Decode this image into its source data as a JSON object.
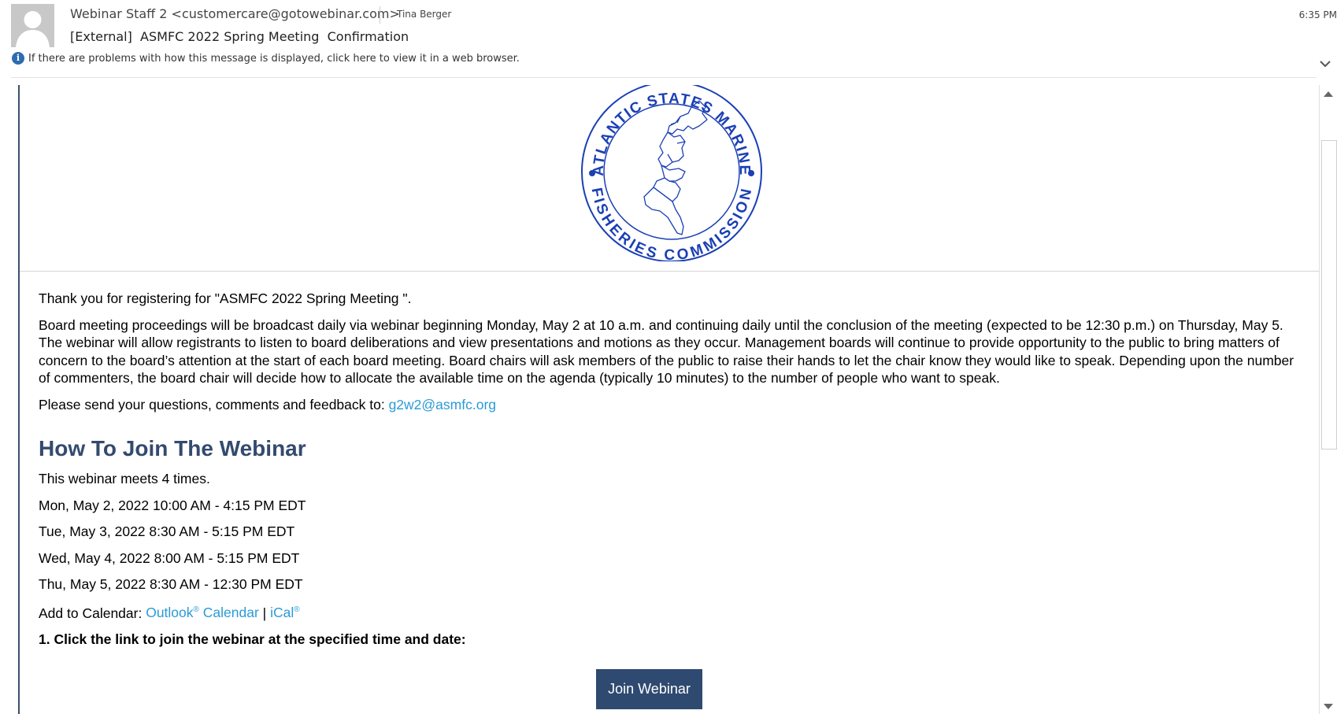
{
  "header": {
    "from": "Webinar Staff 2 <customercare@gotowebinar.com>",
    "to": "Tina Berger",
    "time": "6:35 PM",
    "subject": "[External]  ASMFC 2022 Spring Meeting  Confirmation",
    "info_text": "If there are problems with how this message is displayed, click here to view it in a web browser."
  },
  "logo": {
    "top_text": "ATLANTIC STATES MARINE",
    "bottom_text": "FISHERIES COMMISSION",
    "color": "#1a3fb5"
  },
  "email": {
    "thanks": "Thank you for registering for \"ASMFC 2022 Spring Meeting \".",
    "paragraph": "Board meeting proceedings will be broadcast daily via webinar beginning Monday, May 2 at 10 a.m. and continuing daily until the conclusion of the meeting (expected to be 12:30 p.m.) on Thursday, May 5. The webinar will allow registrants to listen to board deliberations and view presentations and motions as they occur. Management boards will continue to provide opportunity to the public to bring matters of concern to the board’s attention at the start of each board meeting. Board chairs will ask members of the public to raise their hands to let the chair know they would like to speak. Depending upon the number of commenters, the board chair will decide how to allocate the available time on the agenda (typically 10 minutes) to the number of people who want to speak.",
    "feedback_text": "Please send your questions, comments and feedback to: ",
    "feedback_email": "g2w2@asmfc.org",
    "heading": "How To Join The Webinar",
    "meets": "This webinar meets 4 times.",
    "sessions": [
      "Mon, May 2, 2022 10:00 AM - 4:15 PM EDT",
      "Tue, May 3, 2022 8:30 AM - 5:15 PM EDT",
      "Wed, May 4, 2022 8:00 AM - 5:15 PM EDT",
      "Thu, May 5, 2022 8:30 AM - 12:30 PM EDT"
    ],
    "calendar_label": "Add to Calendar: ",
    "outlook": "Outlook",
    "outlook_reg": "®",
    "calendar_word": " Calendar",
    "pipe": " | ",
    "ical": "iCal",
    "ical_reg": "®",
    "step1": "1. Click the link to join the webinar at the specified time and date:",
    "join_button": "Join Webinar"
  },
  "colors": {
    "link": "#2a9bd6",
    "heading": "#344a6e",
    "button": "#2f4a70"
  }
}
